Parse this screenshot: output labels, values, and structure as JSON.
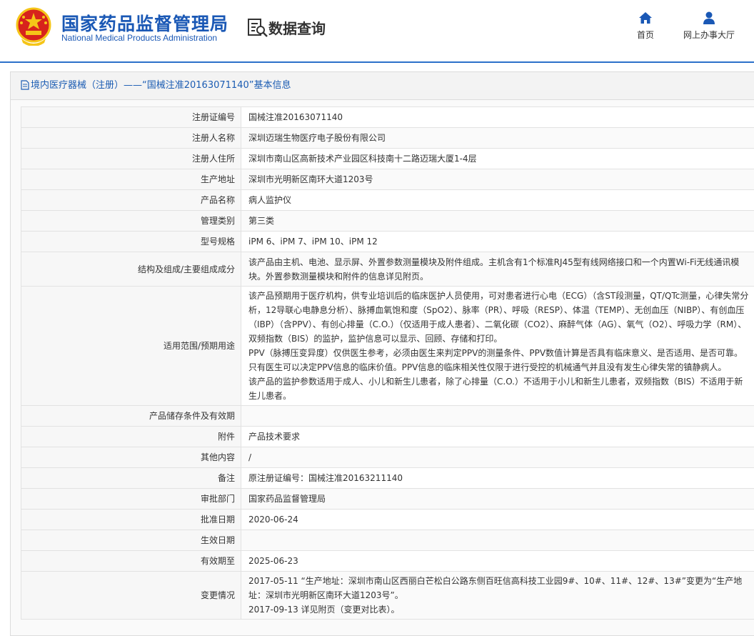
{
  "header": {
    "org_cn": "国家药品监督管理局",
    "org_en": "National Medical Products Administration",
    "section_title": "数据查询",
    "nav": [
      {
        "label": "首页",
        "icon": "home-icon"
      },
      {
        "label": "网上办事大厅",
        "icon": "user-icon"
      }
    ],
    "colors": {
      "brand_blue": "#1a58b5",
      "emblem_red": "#d7231c",
      "emblem_gold": "#f5c518"
    }
  },
  "panel": {
    "title": "境内医疗器械（注册）——“国械注准20163071140”基本信息"
  },
  "rows": [
    {
      "label": "注册证编号",
      "value": "国械注准20163071140"
    },
    {
      "label": "注册人名称",
      "value": "深圳迈瑞生物医疗电子股份有限公司"
    },
    {
      "label": "注册人住所",
      "value": "深圳市南山区高新技术产业园区科技南十二路迈瑞大厦1-4层"
    },
    {
      "label": "生产地址",
      "value": "深圳市光明新区南环大道1203号"
    },
    {
      "label": "产品名称",
      "value": "病人监护仪"
    },
    {
      "label": "管理类别",
      "value": "第三类"
    },
    {
      "label": "型号规格",
      "value": "iPM 6、iPM 7、iPM 10、iPM 12"
    },
    {
      "label": "结构及组成/主要组成成分",
      "value": "该产品由主机、电池、显示屏、外置参数测量模块及附件组成。主机含有1个标准RJ45型有线网络接口和一个内置Wi-Fi无线通讯模块。外置参数测量模块和附件的信息详见附页。"
    },
    {
      "label": "适用范围/预期用途",
      "value": "该产品预期用于医疗机构，供专业培训后的临床医护人员使用，可对患者进行心电（ECG）（含ST段测量，QT/QTc测量，心律失常分析，12导联心电静息分析）、脉搏血氧饱和度（SpO2）、脉率（PR）、呼吸（RESP）、体温（TEMP）、无创血压（NIBP）、有创血压（IBP）（含PPV）、有创心排量（C.O.）（仅适用于成人患者）、二氧化碳（CO2）、麻醉气体（AG）、氧气（O2）、呼吸力学（RM）、双频指数（BIS）的监护，监护信息可以显示、回顾、存储和打印。\nPPV（脉搏压变异度）仅供医生参考，必须由医生来判定PPV的测量条件、PPV数值计算是否具有临床意义、是否适用、是否可靠。只有医生可以决定PPV信息的临床价值。PPV信息的临床相关性仅限于进行受控的机械通气并且没有发生心律失常的镇静病人。\n该产品的监护参数适用于成人、小儿和新生儿患者，除了心排量（C.O.）不适用于小儿和新生儿患者，双频指数（BIS）不适用于新生儿患者。"
    },
    {
      "label": "产品储存条件及有效期",
      "value": ""
    },
    {
      "label": "附件",
      "value": "产品技术要求"
    },
    {
      "label": "其他内容",
      "value": "/"
    },
    {
      "label": "备注",
      "value": "原注册证编号：国械注准20163211140"
    },
    {
      "label": "审批部门",
      "value": "国家药品监督管理局"
    },
    {
      "label": "批准日期",
      "value": "2020-06-24"
    },
    {
      "label": "生效日期",
      "value": ""
    },
    {
      "label": "有效期至",
      "value": "2025-06-23"
    },
    {
      "label": "变更情况",
      "value": "2017-05-11 “生产地址：深圳市南山区西丽白芒松白公路东侧百旺信高科技工业园9#、10#、11#、12#、13#”变更为“生产地址：深圳市光明新区南环大道1203号”。\n2017-09-13 详见附页（变更对比表）。"
    }
  ]
}
